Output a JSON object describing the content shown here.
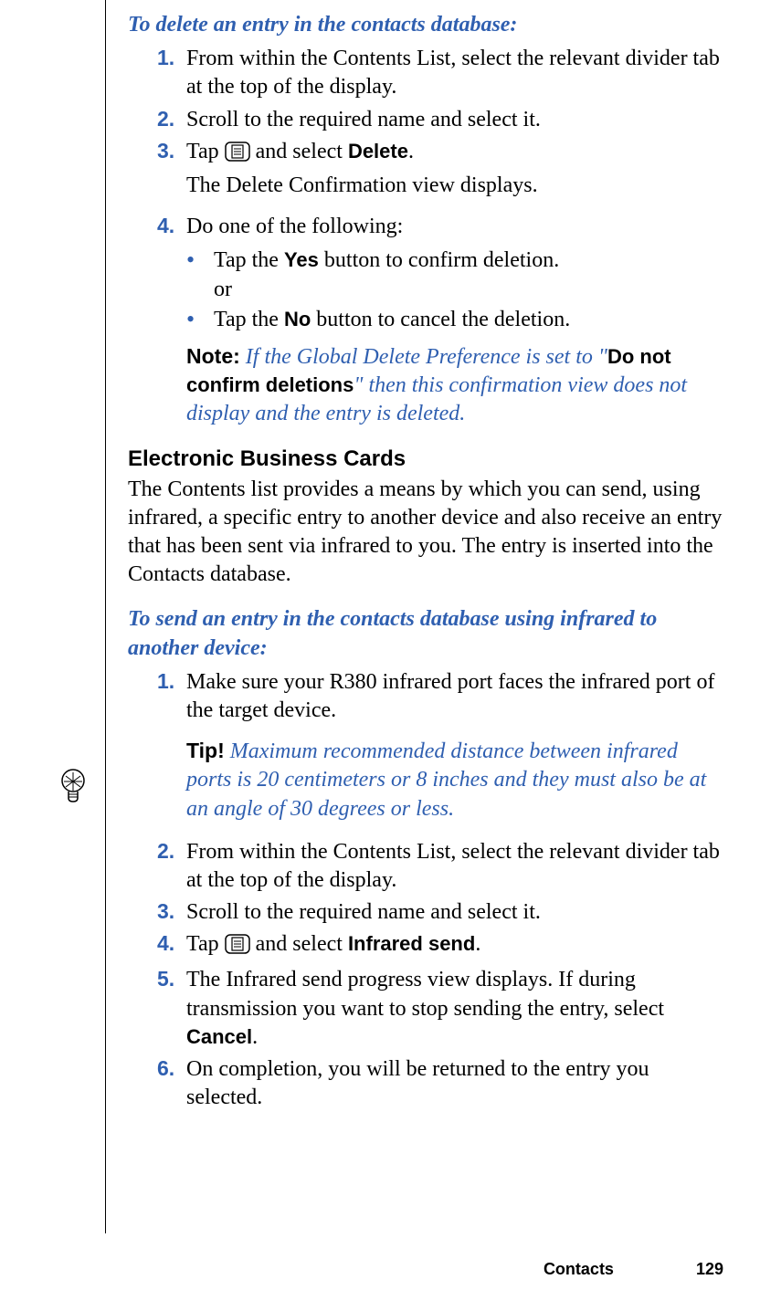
{
  "delete_section": {
    "heading": "To delete an entry in the contacts database:",
    "steps": [
      {
        "num": "1.",
        "text": "From within the Contents List, select the relevant divider tab at the top of the display."
      },
      {
        "num": "2.",
        "text": "Scroll to the required name and select it."
      },
      {
        "num": "3.",
        "pre": "Tap ",
        "bold1": "Delete",
        "mid": " and select ",
        "post": ".",
        "after": "The Delete Confirmation view displays."
      },
      {
        "num": "4.",
        "text": "Do one of the following:"
      }
    ],
    "bullets": [
      {
        "pre": "Tap the ",
        "bold": "Yes",
        "post": " button to confirm deletion.",
        "extra": "or"
      },
      {
        "pre": "Tap the ",
        "bold": "No",
        "post": " button to cancel the deletion."
      }
    ],
    "note": {
      "label": "Note:",
      "pre": "If the Global Delete Preference is set to \"",
      "bold": "Do not confirm deletions",
      "post": "\" then this confirmation view does not display and the entry is deleted."
    }
  },
  "ebc_section": {
    "heading": "Electronic Business Cards",
    "para": "The Contents list provides a means by which you can send, using infrared, a specific entry to another device and also receive an entry that has been sent via infrared to you. The entry is inserted into the Contacts database."
  },
  "send_section": {
    "heading": "To send an entry in the contacts database using infrared to another device:",
    "steps": [
      {
        "num": "1.",
        "text": "Make sure your R380 infrared port faces the infrared port of the target device."
      }
    ],
    "tip": {
      "label": "Tip!",
      "text": "Maximum recommended distance between infrared ports is 20 centimeters or 8 inches and they must also be at an angle of 30 degrees or less."
    },
    "steps2": [
      {
        "num": "2.",
        "text": "From within the Contents List, select the relevant divider tab at the top of the display."
      },
      {
        "num": "3.",
        "text": "Scroll to the required name and select it."
      },
      {
        "num": "4.",
        "pre": "Tap ",
        "mid": " and select ",
        "bold1": "Infrared send",
        "post": "."
      },
      {
        "num": "5.",
        "pre": "The Infrared send progress view displays. If during transmission you want to stop sending the entry, select ",
        "bold1": "Cancel",
        "post": "."
      },
      {
        "num": "6.",
        "text": "On completion, you will be returned to the entry you selected."
      }
    ]
  },
  "footer": {
    "section": "Contacts",
    "page": "129"
  }
}
